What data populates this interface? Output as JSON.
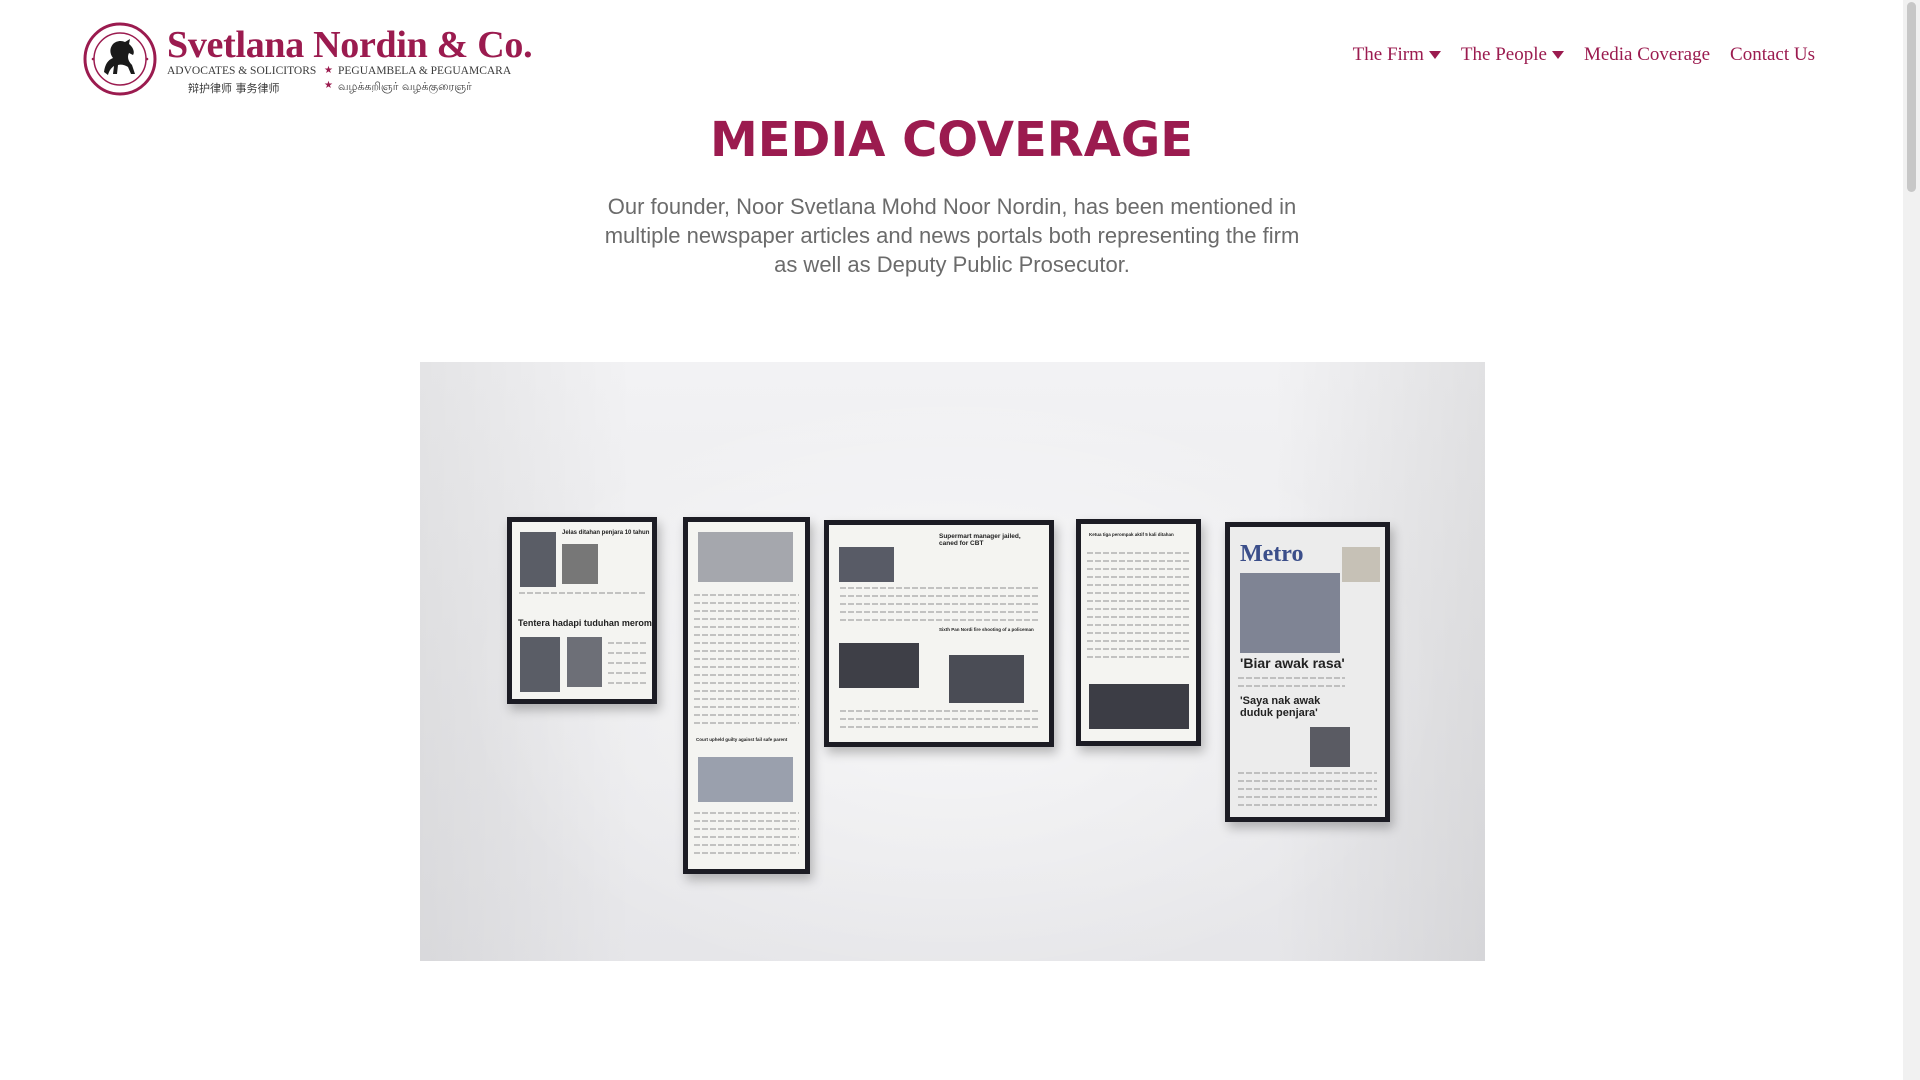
{
  "brand": {
    "name": "Svetlana Nordin & Co.",
    "tagline_en": "ADVOCATES & SOLICITORS",
    "tagline_ms": "PEGUAMBELA & PEGUAMCARA",
    "tagline_zh": "辩护律师  事务律师",
    "tagline_ta": "வழக்கறிஞர் வழக்குரைஞர்",
    "accent_color": "#9b1b4f"
  },
  "nav": {
    "items": [
      {
        "label": "The Firm",
        "has_dropdown": true
      },
      {
        "label": "The People",
        "has_dropdown": true
      },
      {
        "label": "Media Coverage",
        "has_dropdown": false
      },
      {
        "label": "Contact Us",
        "has_dropdown": false
      }
    ]
  },
  "main": {
    "title": "MEDIA COVERAGE",
    "intro": "Our founder, Noor Svetlana Mohd Noor Nordin, has been mentioned in multiple newspaper articles and news portals both representing the firm as well as Deputy Public Prosecutor."
  },
  "photo": {
    "clippings": [
      {
        "headline_1": "Jelas ditahan penjara 10 tahun",
        "headline_2": "Tentera hadapi tuduhan merompak"
      },
      {
        "headline_1": "Court upheld guilty against fail safe parent"
      },
      {
        "headline_1": "Supermart manager jailed, caned for CBT",
        "headline_2": "Sixth Pan Nordi fire shooting of a policeman"
      },
      {
        "headline_1": "Ketua tiga perompak aktif 5 kali ditahan"
      },
      {
        "headline_1": "Metro",
        "headline_2": "'Biar awak rasa'",
        "headline_3": "'Saya nak awak duduk penjara'"
      }
    ]
  }
}
